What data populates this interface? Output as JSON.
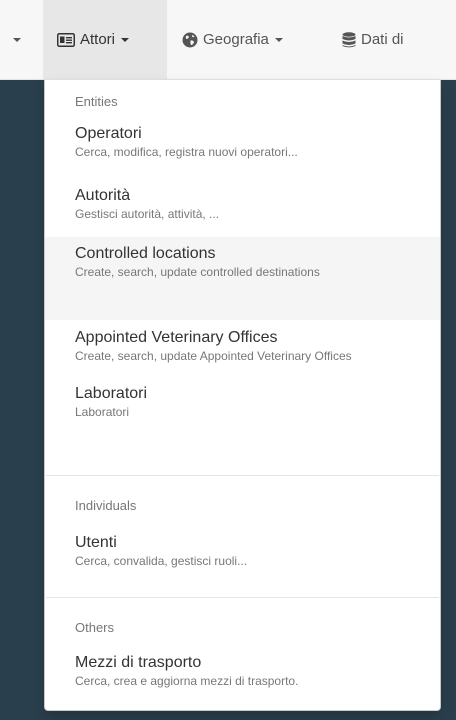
{
  "navbar": {
    "items": [
      {
        "label": "Attori",
        "icon": "id-card-icon"
      },
      {
        "label": "Geografia",
        "icon": "globe-icon"
      },
      {
        "label": "Dati di",
        "icon": "database-icon"
      }
    ]
  },
  "dropdown": {
    "sections": [
      {
        "header": "Entities",
        "items": [
          {
            "title": "Operatori",
            "desc": "Cerca, modifica, registra nuovi operatori..."
          },
          {
            "title": "Autorità",
            "desc": "Gestisci autorità, attività, ..."
          },
          {
            "title": "Controlled locations",
            "desc": "Create, search, update controlled destinations"
          },
          {
            "title": "Appointed Veterinary Offices",
            "desc": "Create, search, update Appointed Veterinary Offices"
          },
          {
            "title": "Laboratori",
            "desc": "Laboratori"
          }
        ]
      },
      {
        "header": "Individuals",
        "items": [
          {
            "title": "Utenti",
            "desc": "Cerca, convalida, gestisci ruoli..."
          }
        ]
      },
      {
        "header": "Others",
        "items": [
          {
            "title": "Mezzi di trasporto",
            "desc": "Cerca, crea e aggiorna mezzi di trasporto."
          }
        ]
      }
    ]
  }
}
